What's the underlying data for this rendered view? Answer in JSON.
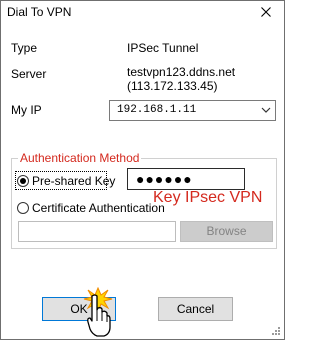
{
  "window": {
    "title": "Dial To VPN"
  },
  "info": {
    "type_label": "Type",
    "type_value": "IPSec Tunnel",
    "server_label": "Server",
    "server_host": "testvpn123.ddns.net",
    "server_ip": "(113.172.133.45)"
  },
  "myip": {
    "label": "My IP",
    "selected": "192.168.1.11"
  },
  "auth": {
    "group_title": "Authentication Method",
    "preshared_label": "Pre-shared Key",
    "preshared_selected": true,
    "preshared_value": "●●●●●●",
    "annotation": "Key IPsec VPN",
    "cert_label": "Certificate Authentication",
    "cert_path": "",
    "browse_label": "Browse"
  },
  "buttons": {
    "ok": "OK",
    "cancel": "Cancel"
  },
  "colors": {
    "accent_red": "#d4291e",
    "focus_blue": "#0078d7"
  }
}
